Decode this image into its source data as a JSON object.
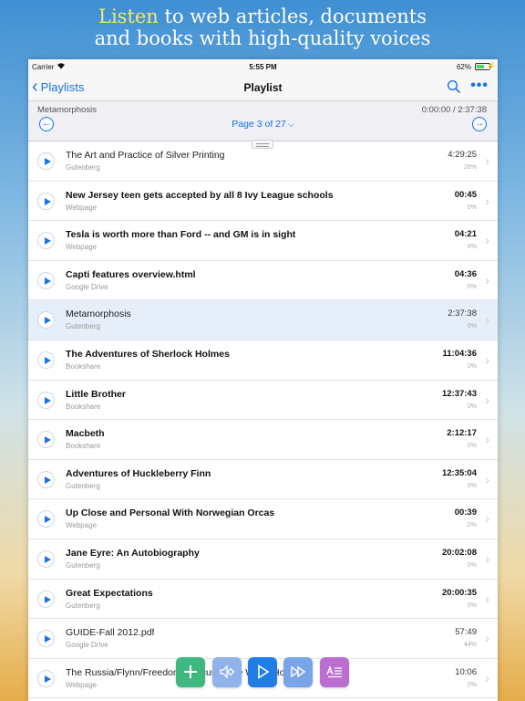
{
  "headline": {
    "accent": "Listen",
    "line1_rest": " to web articles, documents",
    "line2": "and books with high-quality voices"
  },
  "status": {
    "carrier": "Carrier",
    "time": "5:55 PM",
    "battery": "62%",
    "battery_level": 0.62
  },
  "nav": {
    "back_label": "Playlists",
    "title": "Playlist"
  },
  "player": {
    "now_title": "Metamorphosis",
    "time": "0:00:00 / 2:37:38",
    "page_label": "Page 3 of 27"
  },
  "items": [
    {
      "title": "The Art and Practice of Silver Printing",
      "source": "Gutenberg",
      "duration": "4:29:25",
      "progress": "26%",
      "bold": false,
      "selected": false
    },
    {
      "title": "New Jersey teen gets accepted by all 8 Ivy League schools",
      "source": "Webpage",
      "duration": "00:45",
      "progress": "0%",
      "bold": true,
      "selected": false
    },
    {
      "title": "Tesla is worth more than Ford -- and GM is in sight",
      "source": "Webpage",
      "duration": "04:21",
      "progress": "0%",
      "bold": true,
      "selected": false
    },
    {
      "title": "Capti features overview.html",
      "source": "Google Drive",
      "duration": "04:36",
      "progress": "0%",
      "bold": true,
      "selected": false
    },
    {
      "title": "Metamorphosis",
      "source": "Gutenberg",
      "duration": "2:37:38",
      "progress": "0%",
      "bold": false,
      "selected": true
    },
    {
      "title": "The Adventures of Sherlock Holmes",
      "source": "Bookshare",
      "duration": "11:04:36",
      "progress": "0%",
      "bold": true,
      "selected": false
    },
    {
      "title": "Little Brother",
      "source": "Bookshare",
      "duration": "12:37:43",
      "progress": "0%",
      "bold": true,
      "selected": false
    },
    {
      "title": "Macbeth",
      "source": "Bookshare",
      "duration": "2:12:17",
      "progress": "0%",
      "bold": true,
      "selected": false
    },
    {
      "title": "Adventures of Huckleberry Finn",
      "source": "Gutenberg",
      "duration": "12:35:04",
      "progress": "0%",
      "bold": true,
      "selected": false
    },
    {
      "title": "Up Close and Personal With Norwegian Orcas",
      "source": "Webpage",
      "duration": "00:39",
      "progress": "0%",
      "bold": true,
      "selected": false
    },
    {
      "title": "Jane Eyre: An Autobiography",
      "source": "Gutenberg",
      "duration": "20:02:08",
      "progress": "0%",
      "bold": true,
      "selected": false
    },
    {
      "title": "Great Expectations",
      "source": "Gutenberg",
      "duration": "20:00:35",
      "progress": "0%",
      "bold": true,
      "selected": false
    },
    {
      "title": "GUIDE-Fall 2012.pdf",
      "source": "Google Drive",
      "duration": "57:49",
      "progress": "44%",
      "bold": false,
      "selected": false
    },
    {
      "title": "The Russia/Flynn/Freedom Caucus                                                    at the White House",
      "source": "Webpage",
      "duration": "10:06",
      "progress": "0%",
      "bold": false,
      "selected": false
    }
  ],
  "icons": {
    "back": "chevron-left-icon",
    "search": "search-icon",
    "more": "more-icon",
    "prev": "arrow-left-icon",
    "next": "arrow-right-icon",
    "play": "play-icon",
    "add": "plus-icon",
    "voice": "speaker-settings-icon",
    "fast_forward": "fast-forward-icon",
    "text": "text-view-icon"
  },
  "colors": {
    "accent": "#1a73e8",
    "headline_accent": "#f2ea6a",
    "add": "#3fb87f",
    "play": "#1f7de4",
    "text": "#b96ed0"
  }
}
